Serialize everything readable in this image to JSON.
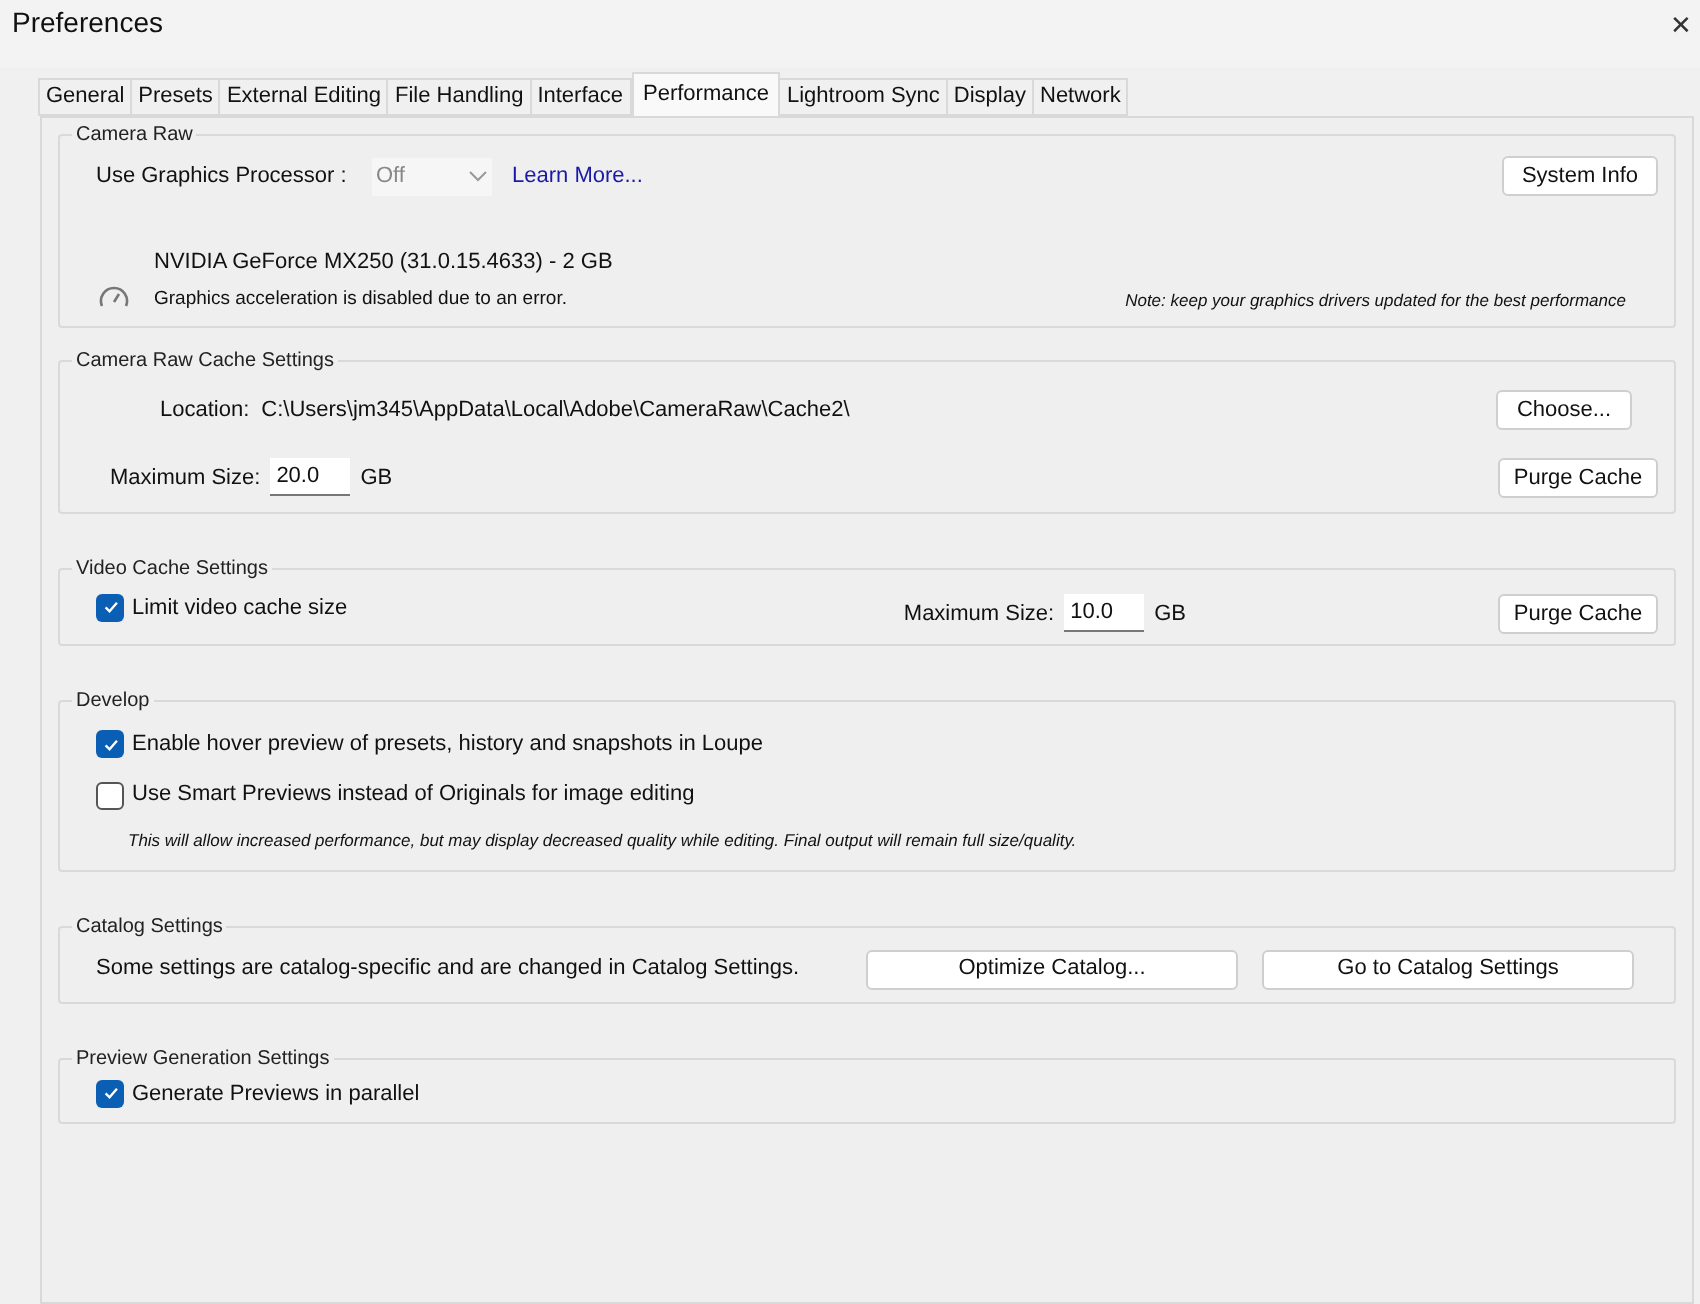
{
  "window": {
    "title": "Preferences",
    "close": "✕"
  },
  "tabs": [
    {
      "label": "General",
      "selected": false
    },
    {
      "label": "Presets",
      "selected": false
    },
    {
      "label": "External Editing",
      "selected": false
    },
    {
      "label": "File Handling",
      "selected": false
    },
    {
      "label": "Interface",
      "selected": false
    },
    {
      "label": "Performance",
      "selected": true
    },
    {
      "label": "Lightroom Sync",
      "selected": false
    },
    {
      "label": "Display",
      "selected": false
    },
    {
      "label": "Network",
      "selected": false
    }
  ],
  "camera_raw": {
    "title": "Camera Raw",
    "gpu_label": "Use Graphics Processor :",
    "gpu_select": {
      "value": "Off",
      "disabled": true
    },
    "learn_more": "Learn More...",
    "system_info_button": "System Info",
    "gpu_name": "NVIDIA GeForce MX250 (31.0.15.4633) - 2 GB",
    "gpu_status": "Graphics acceleration is disabled due to an error.",
    "note": "Note: keep your graphics drivers updated for the best performance"
  },
  "camera_raw_cache": {
    "title": "Camera Raw Cache Settings",
    "location_label": "Location:",
    "location_path": "C:\\Users\\jm345\\AppData\\Local\\Adobe\\CameraRaw\\Cache2\\",
    "choose_button": "Choose...",
    "max_size_label": "Maximum Size:",
    "max_size_value": "20.0",
    "unit": "GB",
    "purge_button": "Purge Cache"
  },
  "video_cache": {
    "title": "Video Cache Settings",
    "limit": {
      "label": "Limit video cache size",
      "checked": true
    },
    "max_size_label": "Maximum Size:",
    "max_size_value": "10.0",
    "unit": "GB",
    "purge_button": "Purge Cache"
  },
  "develop": {
    "title": "Develop",
    "options": [
      {
        "label": "Enable hover preview of presets, history and snapshots in Loupe",
        "checked": true
      },
      {
        "label": "Use Smart Previews instead of Originals for image editing",
        "checked": false
      }
    ],
    "note": "This will allow increased performance, but may display decreased quality while editing. Final output will remain full size/quality."
  },
  "catalog": {
    "title": "Catalog Settings",
    "text": "Some settings are catalog-specific and are changed in Catalog Settings.",
    "buttons": [
      "Optimize Catalog...",
      "Go to Catalog Settings"
    ]
  },
  "preview_generation": {
    "title": "Preview Generation Settings",
    "option": {
      "label": "Generate Previews in parallel",
      "checked": true
    }
  }
}
